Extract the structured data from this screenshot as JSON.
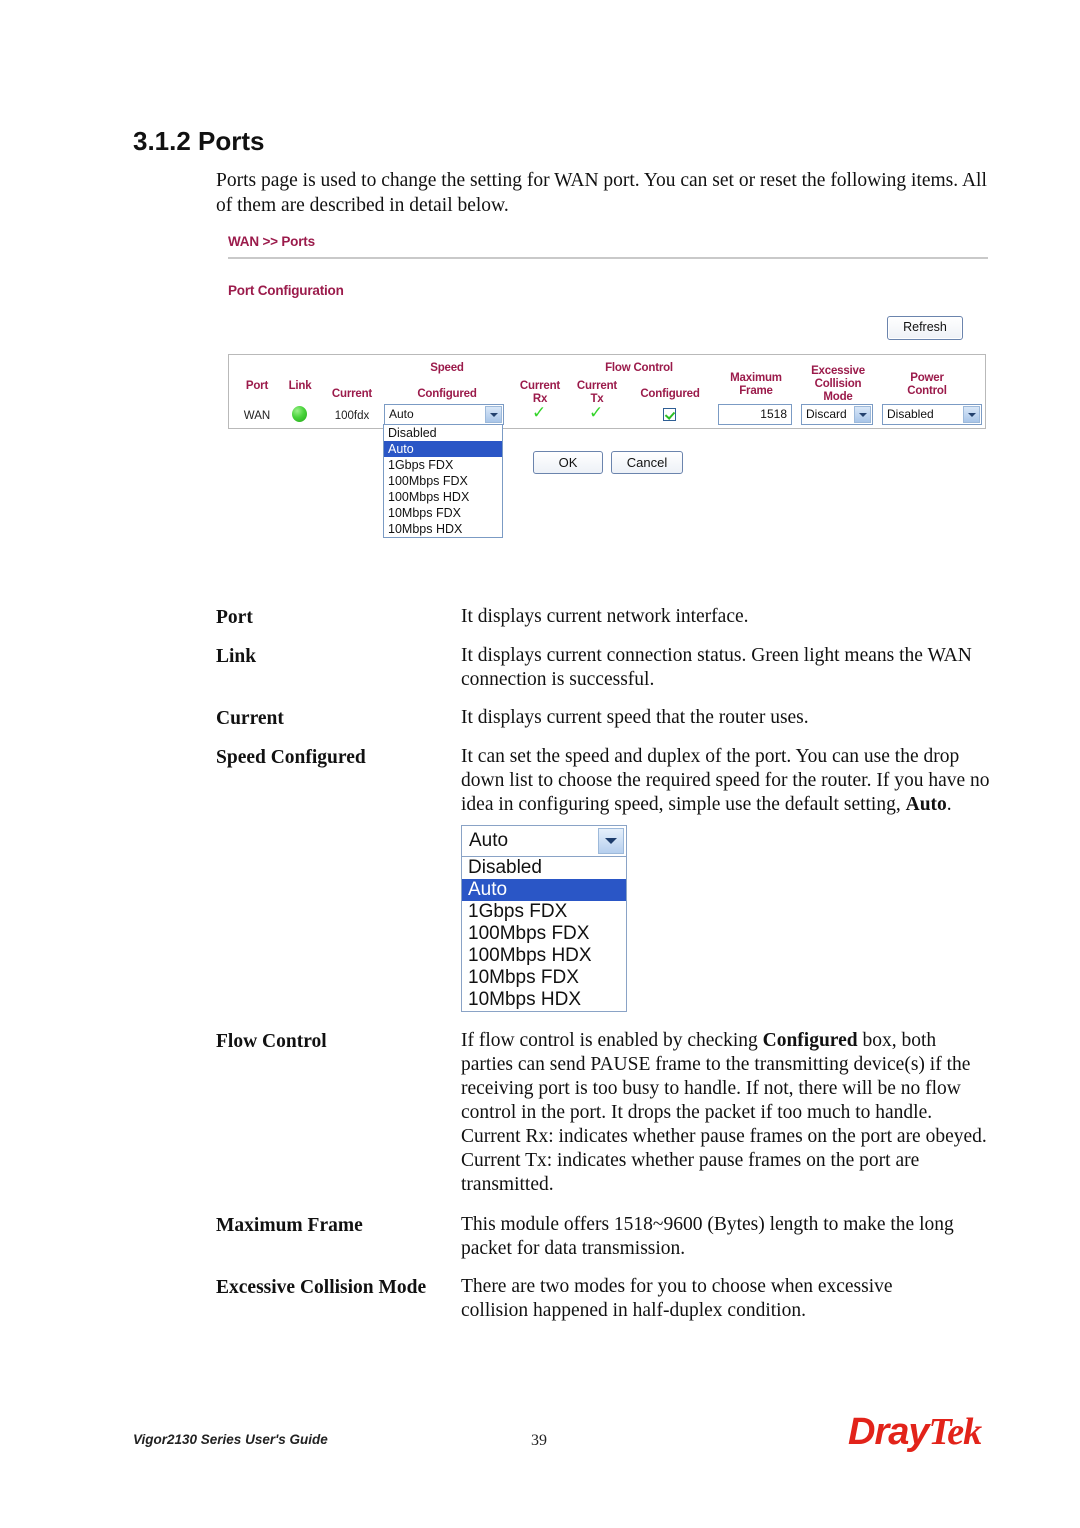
{
  "document": {
    "section_number_title": "3.1.2 Ports",
    "intro_paragraph": "Ports page is used to change the setting for WAN port. You can set or reset the following items. All of them are described in detail below."
  },
  "router_ui": {
    "breadcrumb": "WAN >> Ports",
    "subtitle": "Port Configuration",
    "refresh_label": "Refresh",
    "table_headers": {
      "port": "Port",
      "link": "Link",
      "speed_group": "Speed",
      "speed_current": "Current",
      "speed_configured": "Configured",
      "flow_control_group": "Flow Control",
      "fc_current_rx": "Current\nRx",
      "fc_current_rx_line1": "Current",
      "fc_current_rx_line2": "Rx",
      "fc_current_tx_line1": "Current",
      "fc_current_tx_line2": "Tx",
      "fc_configured": "Configured",
      "maximum_frame_line1": "Maximum",
      "maximum_frame_line2": "Frame",
      "excessive_collision_line1": "Excessive",
      "excessive_collision_line2": "Collision",
      "excessive_collision_line3": "Mode",
      "power_control_line1": "Power",
      "power_control_line2": "Control"
    },
    "row": {
      "port": "WAN",
      "link_state": "green-led-on",
      "speed_current": "100fdx",
      "speed_configured_value": "Auto",
      "fc_current_rx": "✓",
      "fc_current_tx": "✓",
      "fc_configured_checked": true,
      "maximum_frame": "1518",
      "excessive_collision_mode": "Discard",
      "power_control": "Disabled"
    },
    "speed_options": [
      "Disabled",
      "Auto",
      "1Gbps FDX",
      "100Mbps FDX",
      "100Mbps HDX",
      "10Mbps FDX",
      "10Mbps HDX"
    ],
    "speed_selected": "Auto",
    "buttons": {
      "ok": "OK",
      "cancel": "Cancel"
    },
    "colors": {
      "heading_magenta": "#9b1b4b",
      "led_green": "#49d33b",
      "select_highlight": "#2a56c6",
      "check_green": "#35d42b"
    }
  },
  "definitions": [
    {
      "term": "Port",
      "desc": "It displays current network interface."
    },
    {
      "term": "Link",
      "desc": "It displays current connection status. Green light means the WAN connection is successful."
    },
    {
      "term": "Current",
      "desc": "It displays current speed that the router uses."
    },
    {
      "term": "Speed Configured",
      "desc_part1": "It can set the speed and duplex of the port. You can use the drop down list to choose the required speed for the router. If you have no idea in configuring speed, simple use the default setting, ",
      "desc_bold": "Auto",
      "desc_part2": "."
    },
    {
      "term": "Flow Control",
      "desc_part1": "If flow control is enabled by checking ",
      "desc_bold": "Configured",
      "desc_part2": " box, both parties can send PAUSE frame to the transmitting device(s) if the receiving port is too busy to handle. If not, there will be no flow control in the port. It drops the packet if too much to handle.",
      "desc_rx": "Current Rx: indicates whether pause frames on the port are obeyed.",
      "desc_tx": "Current Tx: indicates whether pause frames on the port are transmitted."
    },
    {
      "term": "Maximum Frame",
      "desc": "This module offers 1518~9600 (Bytes) length to make the long packet for data transmission."
    },
    {
      "term": "Excessive Collision Mode",
      "desc": "There are two modes for you to choose when excessive collision happened in half-duplex condition."
    }
  ],
  "footer": {
    "guide_title": "Vigor2130 Series User's Guide",
    "page_number": "39",
    "logo_dray": "Dray",
    "logo_tek": "Tek"
  }
}
